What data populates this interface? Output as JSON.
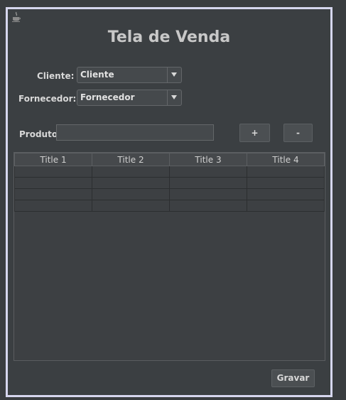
{
  "window": {
    "icon": "java-cup-icon"
  },
  "form": {
    "title": "Tela de Venda",
    "cliente_label": "Cliente:",
    "cliente_value": "Cliente",
    "fornecedor_label": "Fornecedor:",
    "fornecedor_value": "Fornecedor",
    "produto_label": "Produto",
    "produto_value": "",
    "add_label": "+",
    "remove_label": "-",
    "save_label": "Gravar"
  },
  "table": {
    "columns": [
      "Title 1",
      "Title 2",
      "Title 3",
      "Title 4"
    ],
    "rows": [
      [
        "",
        "",
        "",
        ""
      ],
      [
        "",
        "",
        "",
        ""
      ],
      [
        "",
        "",
        "",
        ""
      ],
      [
        "",
        "",
        "",
        ""
      ]
    ]
  }
}
